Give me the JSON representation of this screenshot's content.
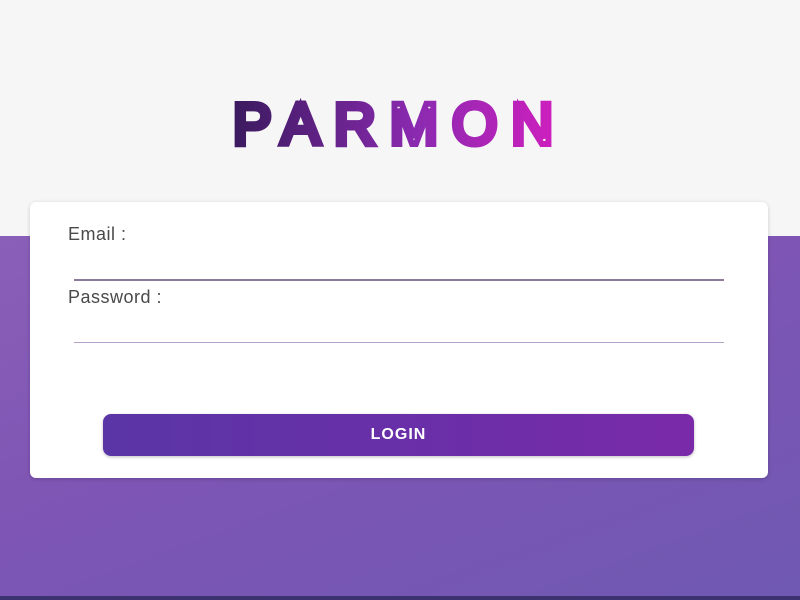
{
  "brand": {
    "logo_text": "PARMON",
    "colors": {
      "start": "#3a1a5e",
      "mid": "#8b2ab0",
      "end": "#d31fbf"
    }
  },
  "form": {
    "email_label": "Email :",
    "email_value": "",
    "password_label": "Password :",
    "password_value": "",
    "login_label": "LOGIN"
  },
  "theme": {
    "background_top": "#f6f6f7",
    "background_bottom": "#7e55b4",
    "button_start": "#5a35a6",
    "button_end": "#7a2aa8"
  }
}
